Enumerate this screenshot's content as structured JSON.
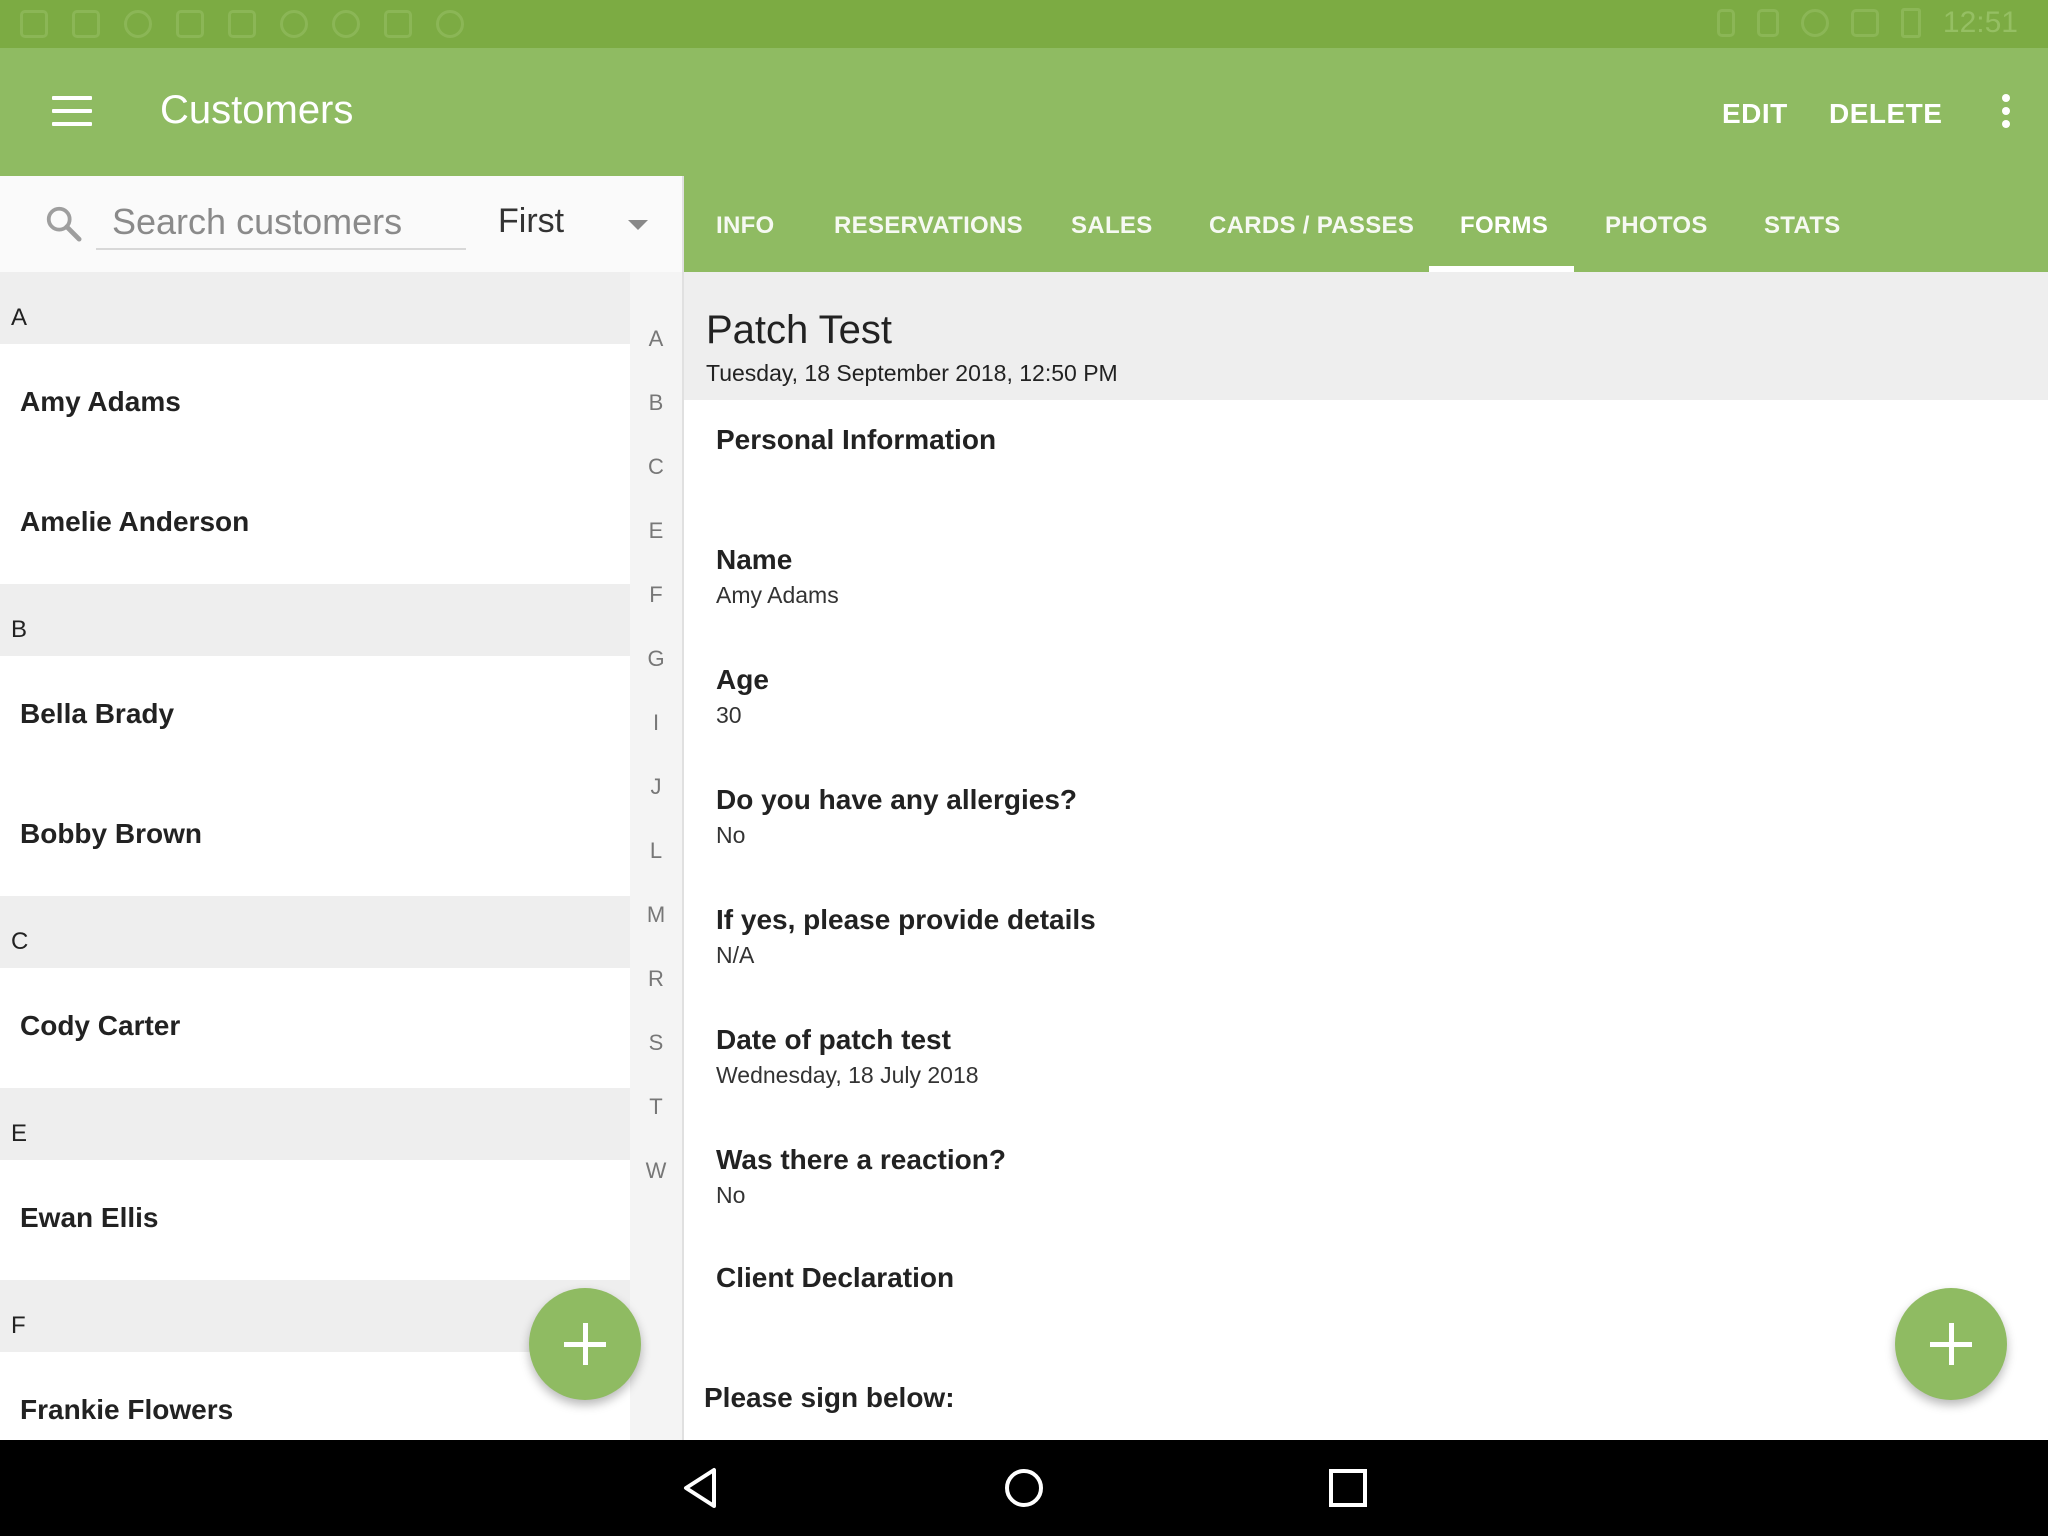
{
  "status_bar": {
    "time": "12:51"
  },
  "app_bar": {
    "title": "Customers",
    "edit_label": "EDIT",
    "delete_label": "DELETE"
  },
  "search": {
    "placeholder": "Search customers",
    "sort_value": "First"
  },
  "customer_list": [
    {
      "header": "A",
      "items": [
        "Amy Adams",
        "Amelie Anderson"
      ]
    },
    {
      "header": "B",
      "items": [
        "Bella Brady",
        "Bobby Brown"
      ]
    },
    {
      "header": "C",
      "items": [
        "Cody Carter"
      ]
    },
    {
      "header": "E",
      "items": [
        "Ewan Ellis"
      ]
    },
    {
      "header": "F",
      "items": [
        "Frankie Flowers"
      ]
    }
  ],
  "index_letters": [
    "A",
    "B",
    "C",
    "E",
    "F",
    "G",
    "I",
    "J",
    "L",
    "M",
    "R",
    "S",
    "T",
    "W"
  ],
  "tabs": [
    "INFO",
    "RESERVATIONS",
    "SALES",
    "CARDS / PASSES",
    "FORMS",
    "PHOTOS",
    "STATS"
  ],
  "active_tab": "FORMS",
  "form": {
    "title": "Patch Test",
    "date": "Tuesday, 18 September 2018, 12:50 PM",
    "section_personal": "Personal Information",
    "fields": [
      {
        "label": "Name",
        "value": "Amy Adams"
      },
      {
        "label": "Age",
        "value": "30"
      },
      {
        "label": "Do you have any allergies?",
        "value": "No"
      },
      {
        "label": "If yes, please provide details",
        "value": "N/A"
      },
      {
        "label": "Date of patch test",
        "value": "Wednesday, 18 July 2018"
      },
      {
        "label": "Was there a reaction?",
        "value": "No"
      }
    ],
    "section_declaration": "Client Declaration",
    "sign_prompt": "Please sign below:"
  },
  "colors": {
    "status_bar": "#7cab43",
    "app_bar": "#8fbb62",
    "section_bg": "#eeeeee",
    "nav_bar": "#000000"
  }
}
